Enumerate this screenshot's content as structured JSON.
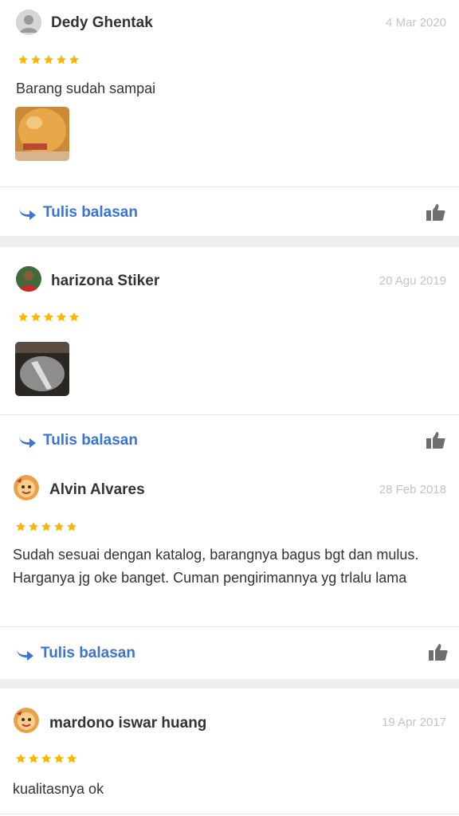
{
  "colors": {
    "star": "#ffb400",
    "link": "#3b73d6",
    "date": "#c4c4c4",
    "name": "#333333"
  },
  "reviews": [
    {
      "name": "Dedy Ghentak",
      "date": "4 Mar 2020",
      "rating": 5,
      "text": "Barang sudah sampai",
      "avatar": "default-user-icon",
      "has_photo": true,
      "reply_label": "Tulis balasan"
    },
    {
      "name": "harizona Stiker",
      "date": "20 Agu 2019",
      "rating": 5,
      "text": "",
      "avatar": "user-photo",
      "has_photo": true,
      "reply_label": "Tulis balasan"
    },
    {
      "name": "Alvin Alvares",
      "date": "28 Feb 2018",
      "rating": 5,
      "text": "Sudah sesuai dengan katalog, barangnya bagus bgt dan mulus. Harganya jg oke banget. Cuman pengirimannya yg trlalu lama",
      "avatar": "cartoon-avatar",
      "has_photo": false,
      "reply_label": "Tulis balasan"
    },
    {
      "name": "mardono iswar huang",
      "date": "19 Apr 2017",
      "rating": 5,
      "text": "kualitasnya ok",
      "avatar": "cartoon-avatar",
      "has_photo": false,
      "reply_label": ""
    }
  ]
}
